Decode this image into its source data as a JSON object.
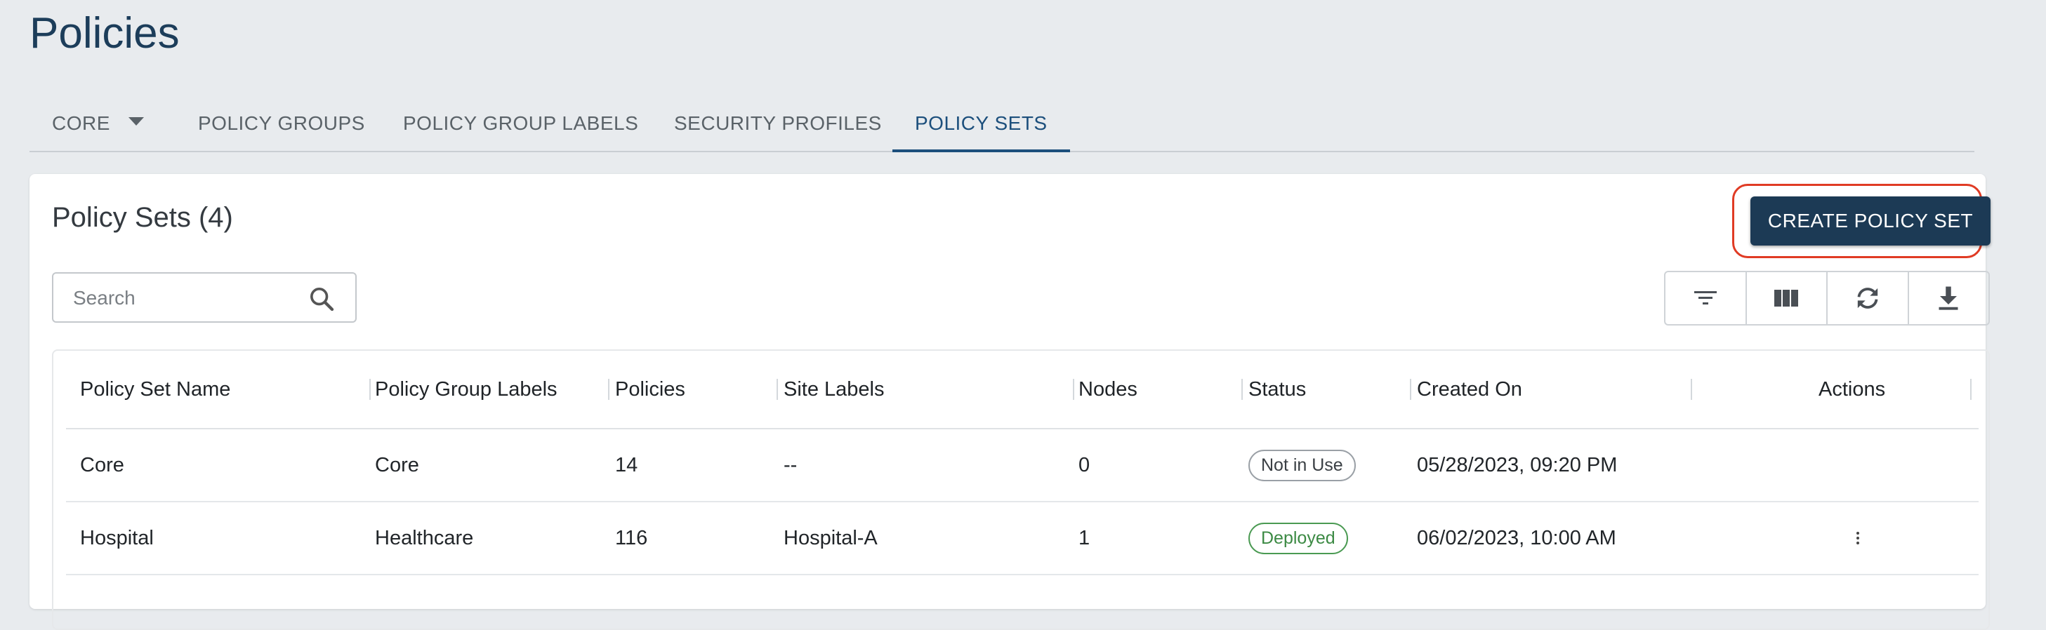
{
  "page": {
    "title": "Policies"
  },
  "tabs": [
    {
      "label": "CORE",
      "active": false,
      "has_dropdown": true
    },
    {
      "label": "POLICY GROUPS",
      "active": false
    },
    {
      "label": "POLICY GROUP LABELS",
      "active": false
    },
    {
      "label": "SECURITY PROFILES",
      "active": false
    },
    {
      "label": "POLICY SETS",
      "active": true
    }
  ],
  "card": {
    "title": "Policy Sets (4)",
    "create_button": "CREATE POLICY SET",
    "search": {
      "placeholder": "Search",
      "value": ""
    },
    "toolbar": [
      "filter-icon",
      "columns-icon",
      "refresh-icon",
      "download-icon"
    ]
  },
  "table": {
    "columns": [
      "Policy Set Name",
      "Policy Group Labels",
      "Policies",
      "Site Labels",
      "Nodes",
      "Status",
      "Created On",
      "Actions"
    ],
    "rows": [
      {
        "name": "Core",
        "group_labels": "Core",
        "policies": "14",
        "site_labels": "--",
        "nodes": "0",
        "status": "Not in Use",
        "created_on": "05/28/2023, 09:20 PM",
        "has_actions": false
      },
      {
        "name": "Hospital",
        "group_labels": "Healthcare",
        "policies": "116",
        "site_labels": "Hospital-A",
        "nodes": "1",
        "status": "Deployed",
        "created_on": "06/02/2023, 10:00 AM",
        "has_actions": true
      }
    ]
  },
  "colors": {
    "primary": "#1c3a55",
    "title": "#1c3d5a",
    "highlight": "#e03b24",
    "deployed": "#3c8a44"
  }
}
